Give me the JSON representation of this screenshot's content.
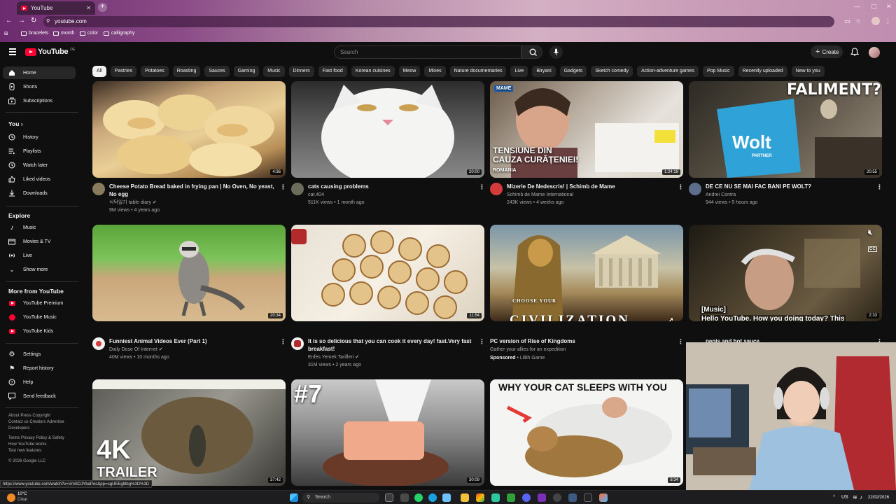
{
  "browser": {
    "tab_title": "YouTube",
    "url": "youtube.com",
    "bookmarks": [
      "bracelets",
      "month",
      "color",
      "calligraphy"
    ]
  },
  "header": {
    "logo_text": "YouTube",
    "logo_country": "DE",
    "search_placeholder": "Search",
    "create_label": "Create"
  },
  "sidebar": {
    "main": [
      {
        "label": "Home",
        "icon": "home-icon"
      },
      {
        "label": "Shorts",
        "icon": "shorts-icon"
      },
      {
        "label": "Subscriptions",
        "icon": "subscriptions-icon"
      }
    ],
    "you_heading": "You",
    "you_items": [
      {
        "label": "History",
        "icon": "history-icon"
      },
      {
        "label": "Playlists",
        "icon": "playlists-icon"
      },
      {
        "label": "Watch later",
        "icon": "watch-later-icon"
      },
      {
        "label": "Liked videos",
        "icon": "liked-icon"
      },
      {
        "label": "Downloads",
        "icon": "download-icon"
      }
    ],
    "explore_heading": "Explore",
    "explore_items": [
      {
        "label": "Music",
        "icon": "music-icon"
      },
      {
        "label": "Movies & TV",
        "icon": "movies-icon"
      },
      {
        "label": "Live",
        "icon": "live-icon"
      },
      {
        "label": "Show more",
        "icon": "chevron-down-icon"
      }
    ],
    "more_heading": "More from YouTube",
    "more_items": [
      {
        "label": "YouTube Premium"
      },
      {
        "label": "YouTube Music"
      },
      {
        "label": "YouTube Kids"
      }
    ],
    "settings_items": [
      {
        "label": "Settings",
        "icon": "gear-icon"
      },
      {
        "label": "Report history",
        "icon": "flag-icon"
      },
      {
        "label": "Help",
        "icon": "help-icon"
      },
      {
        "label": "Send feedback",
        "icon": "feedback-icon"
      }
    ],
    "footer_line1": "About  Press  Copyright",
    "footer_line2": "Contact us  Creators  Advertise",
    "footer_line3": "Developers",
    "footer_line4": "Terms  Privacy  Policy & Safety",
    "footer_line5": "How YouTube works",
    "footer_line6": "Test new features",
    "copyright": "© 2026 Google LLC"
  },
  "chips": [
    "All",
    "Pastries",
    "Potatoes",
    "Roasting",
    "Sauces",
    "Gaming",
    "Music",
    "Dinners",
    "Fast food",
    "Korean cuisines",
    "Meow",
    "Mixes",
    "Nature documentaries",
    "Live",
    "Biryani",
    "Gadgets",
    "Sketch comedy",
    "Action-adventure games",
    "Pop Music",
    "Recently uploaded",
    "New to you"
  ],
  "videos_row1": [
    {
      "title": "Cheese Potato Bread baked in frying pan | No Oven, No yeast, No egg",
      "channel": "식탁일기 table diary",
      "verified": true,
      "meta": "9M views • 4 years ago",
      "duration": "4:36"
    },
    {
      "title": "cats causing problems",
      "channel": "cat.404",
      "meta": "511K views • 1 month ago",
      "duration": "20:00"
    },
    {
      "title": "Mizerie De Nedescris! | Schimb de Mame",
      "channel": "Schimb de Mame International",
      "meta": "243K views • 4 weeks ago",
      "duration": "1:24:19",
      "overlay1": "TENSIUNE DIN",
      "overlay2": "CAUZA CURĂȚENIEI!",
      "overlay3": "ROMANIA",
      "overlay4": "MAME"
    },
    {
      "title": "DE CE NU SE MAI FAC BANI PE WOLT?",
      "channel": "Andrei Contra",
      "meta": "944 views • 5 hours ago",
      "duration": "20:55",
      "overlay1": "FALIMENT?",
      "overlay2": "Wolt",
      "overlay3": "PARTNER"
    }
  ],
  "videos_row2": [
    {
      "title": "Funniest Animal Videos Ever (Part 1)",
      "channel": "Daily Dose Of Internet",
      "verified": true,
      "meta": "40M views • 10 months ago",
      "duration": "20:34"
    },
    {
      "title": "It is so delicious that you can cook it every day! fast.Very fast breakfast!",
      "channel": "Enfes Yemek Tarifleri",
      "verified": true,
      "meta": "31M views • 2 years ago",
      "duration": "11:54"
    },
    {
      "title": "PC version of Rise of Kingdoms",
      "channel": "Gather your allies for an expedition",
      "sponsored": "Sponsored",
      "meta": " • Lilith Game",
      "overlay1": "CHOOSE YOUR",
      "overlay2": "CIVILIZATION"
    },
    {
      "title": "penis and hot sauce",
      "caption_tag": "[Music]",
      "caption": "Hello YouTube. How you doing today? This",
      "duration": "2:33"
    }
  ],
  "videos_row3": [
    {
      "duration": "37:42",
      "overlay1": "4K",
      "overlay2": "TRAILER"
    },
    {
      "duration": "30:09",
      "overlay1": "#7"
    },
    {
      "duration": "8:34",
      "overlay1": "WHY YOUR CAT SLEEPS WITH YOU"
    }
  ],
  "status_url": "https://www.youtube.com/watch?v=VmSDJYbaPes&pp=ugUEEgl8bg%3D%3D",
  "taskbar": {
    "weather_temp": "10°C",
    "weather_desc": "Clear",
    "search_label": "Search",
    "lang": "US",
    "date": "22/02/2026"
  }
}
